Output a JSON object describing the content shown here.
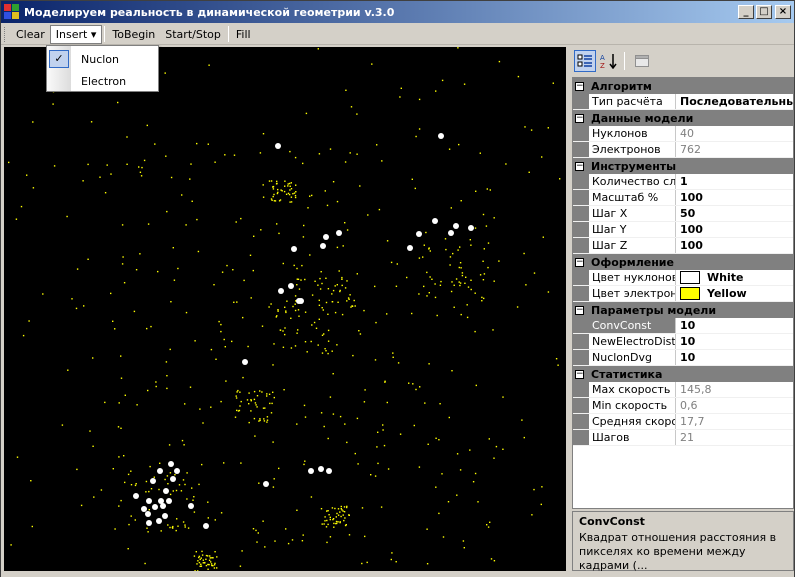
{
  "window": {
    "title": "Моделируем реальность в динамической геометрии v.3.0",
    "minimize": "_",
    "maximize": "□",
    "close": "×"
  },
  "toolbar": {
    "clear": "Clear",
    "insert": "Insert ▾",
    "to_begin": "ToBegin",
    "start_stop": "Start/Stop",
    "fill": "Fill"
  },
  "insert_menu": {
    "items": [
      {
        "label": "Nuclon",
        "checked": true,
        "check_mark": "✓"
      },
      {
        "label": "Electron",
        "checked": false
      }
    ]
  },
  "property_grid": {
    "toolbar_icons": [
      "categorized-icon",
      "alphabetical-icon",
      "property-pages-icon"
    ],
    "collapse_glyph": "−",
    "categories": [
      {
        "name": "Алгоритм",
        "props": [
          {
            "name": "Тип расчёта",
            "value": "Последовательный",
            "readonly": false
          }
        ]
      },
      {
        "name": "Данные модели",
        "props": [
          {
            "name": "Нуклонов",
            "value": "40",
            "readonly": true
          },
          {
            "name": "Электронов",
            "value": "762",
            "readonly": true
          }
        ]
      },
      {
        "name": "Инструменты",
        "props": [
          {
            "name": "Количество слоёв",
            "value": "1",
            "readonly": false
          },
          {
            "name": "Масштаб %",
            "value": "100",
            "readonly": false
          },
          {
            "name": "Шаг X",
            "value": "50",
            "readonly": false
          },
          {
            "name": "Шаг Y",
            "value": "100",
            "readonly": false
          },
          {
            "name": "Шаг Z",
            "value": "100",
            "readonly": false
          }
        ]
      },
      {
        "name": "Оформление",
        "props": [
          {
            "name": "Цвет нуклонов",
            "value": "White",
            "readonly": false,
            "swatch": "#ffffff"
          },
          {
            "name": "Цвет электронов",
            "value": "Yellow",
            "readonly": false,
            "swatch": "#ffff00"
          }
        ]
      },
      {
        "name": "Параметры модели",
        "props": [
          {
            "name": "ConvConst",
            "value": "10",
            "readonly": false,
            "selected": true
          },
          {
            "name": "NewElectroDist",
            "value": "10",
            "readonly": false
          },
          {
            "name": "NuclonDvg",
            "value": "10",
            "readonly": false
          }
        ]
      },
      {
        "name": "Статистика",
        "props": [
          {
            "name": "Max скорость",
            "value": "145,8",
            "readonly": true
          },
          {
            "name": "Min скорость",
            "value": "0,6",
            "readonly": true
          },
          {
            "name": "Средняя скорость",
            "value": "17,7",
            "readonly": true
          },
          {
            "name": "Шагов",
            "value": "21",
            "readonly": true
          }
        ]
      }
    ]
  },
  "help": {
    "title": "ConvConst",
    "description": "Квадрат отношения расстояния в пикселях ко времени между кадрами (..."
  },
  "colors": {
    "nucleon": "#ffffff",
    "electron": "#ffff00",
    "canvas_bg": "#000000"
  }
}
